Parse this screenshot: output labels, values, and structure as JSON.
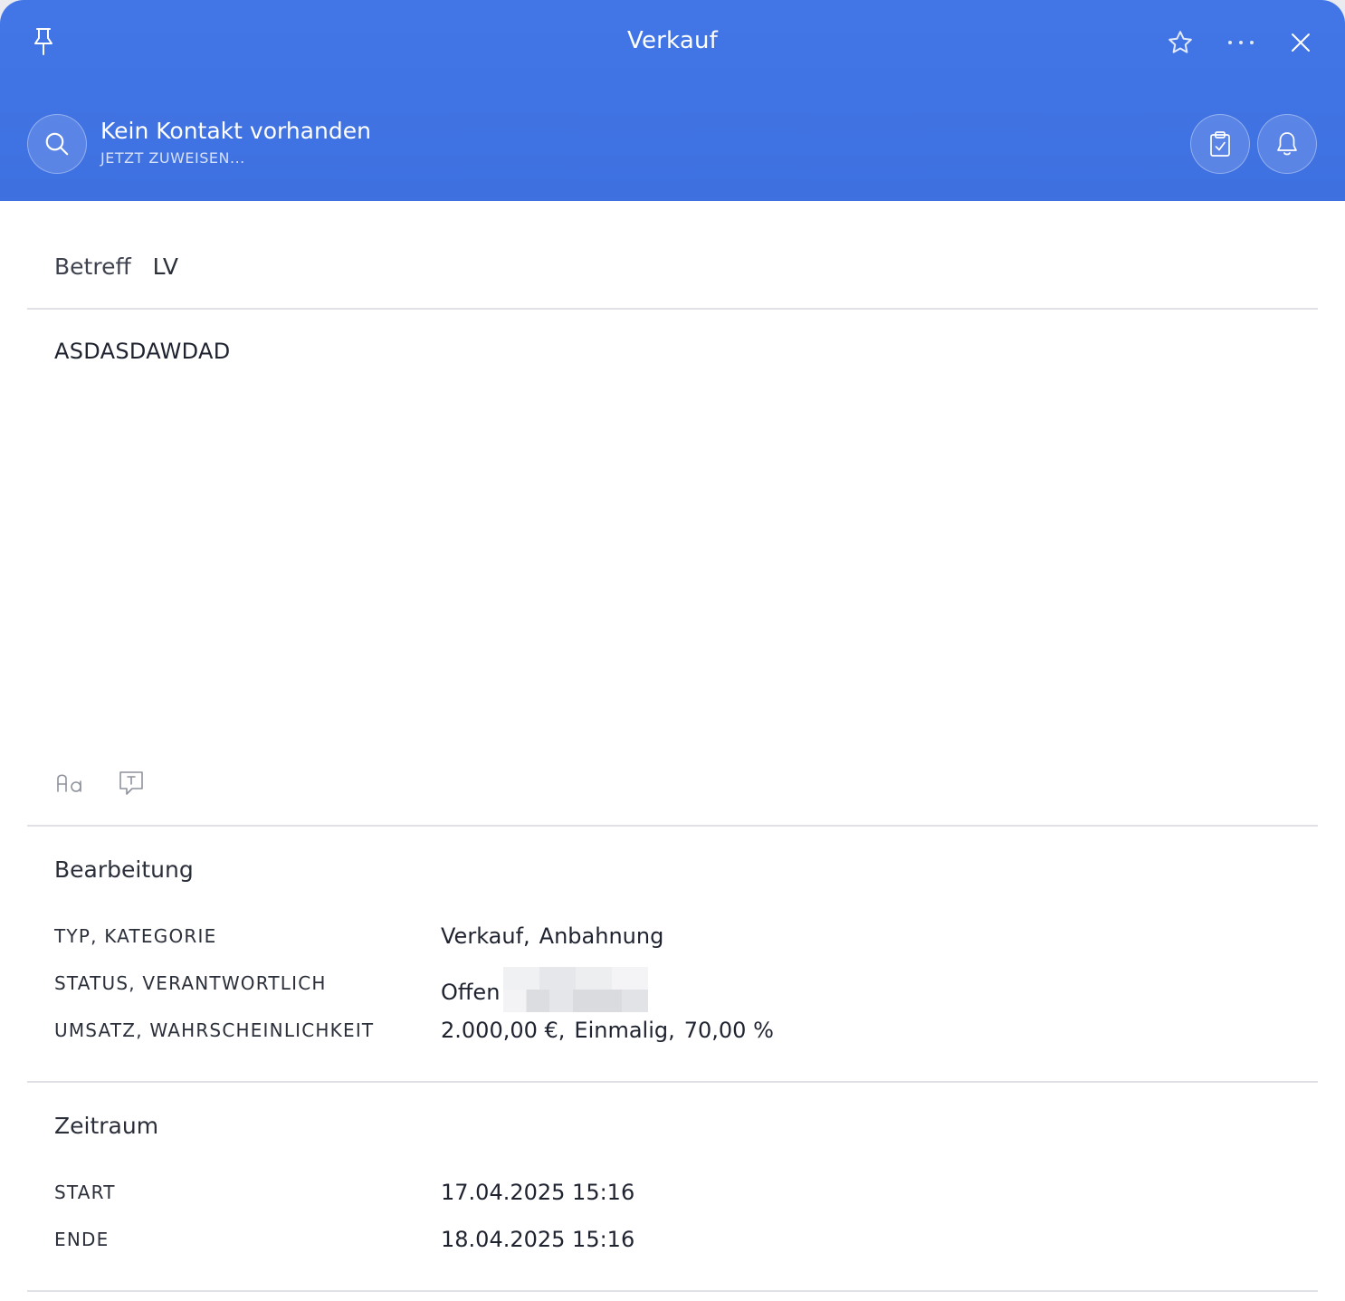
{
  "header": {
    "title": "Verkauf",
    "contact_name": "Kein Kontakt vorhanden",
    "contact_action": "JETZT ZUWEISEN...",
    "accent_color": "#4276e6",
    "icons": [
      "pin-icon",
      "star-icon",
      "more-icon",
      "close-icon",
      "search-icon",
      "clipboard-check-icon",
      "bell-icon"
    ]
  },
  "subject": {
    "label": "Betreff",
    "value": "LV"
  },
  "note": {
    "text": "ASDASDAWDAD",
    "toolbar_icons": [
      "text-format-icon",
      "text-block-icon"
    ]
  },
  "bearbeitung": {
    "title": "Bearbeitung",
    "rows": [
      {
        "label": "TYP, KATEGORIE",
        "values": [
          "Verkauf,",
          "Anbahnung"
        ]
      },
      {
        "label": "STATUS, VERANTWORTLICH",
        "values": [
          "Offen"
        ]
      },
      {
        "label": "UMSATZ, WAHRSCHEINLICHKEIT",
        "values": [
          "2.000,00 €,",
          "Einmalig,",
          "70,00 %"
        ]
      }
    ]
  },
  "zeitraum": {
    "title": "Zeitraum",
    "rows": [
      {
        "label": "START",
        "value": "17.04.2025 15:16"
      },
      {
        "label": "ENDE",
        "value": "18.04.2025 15:16"
      }
    ]
  }
}
